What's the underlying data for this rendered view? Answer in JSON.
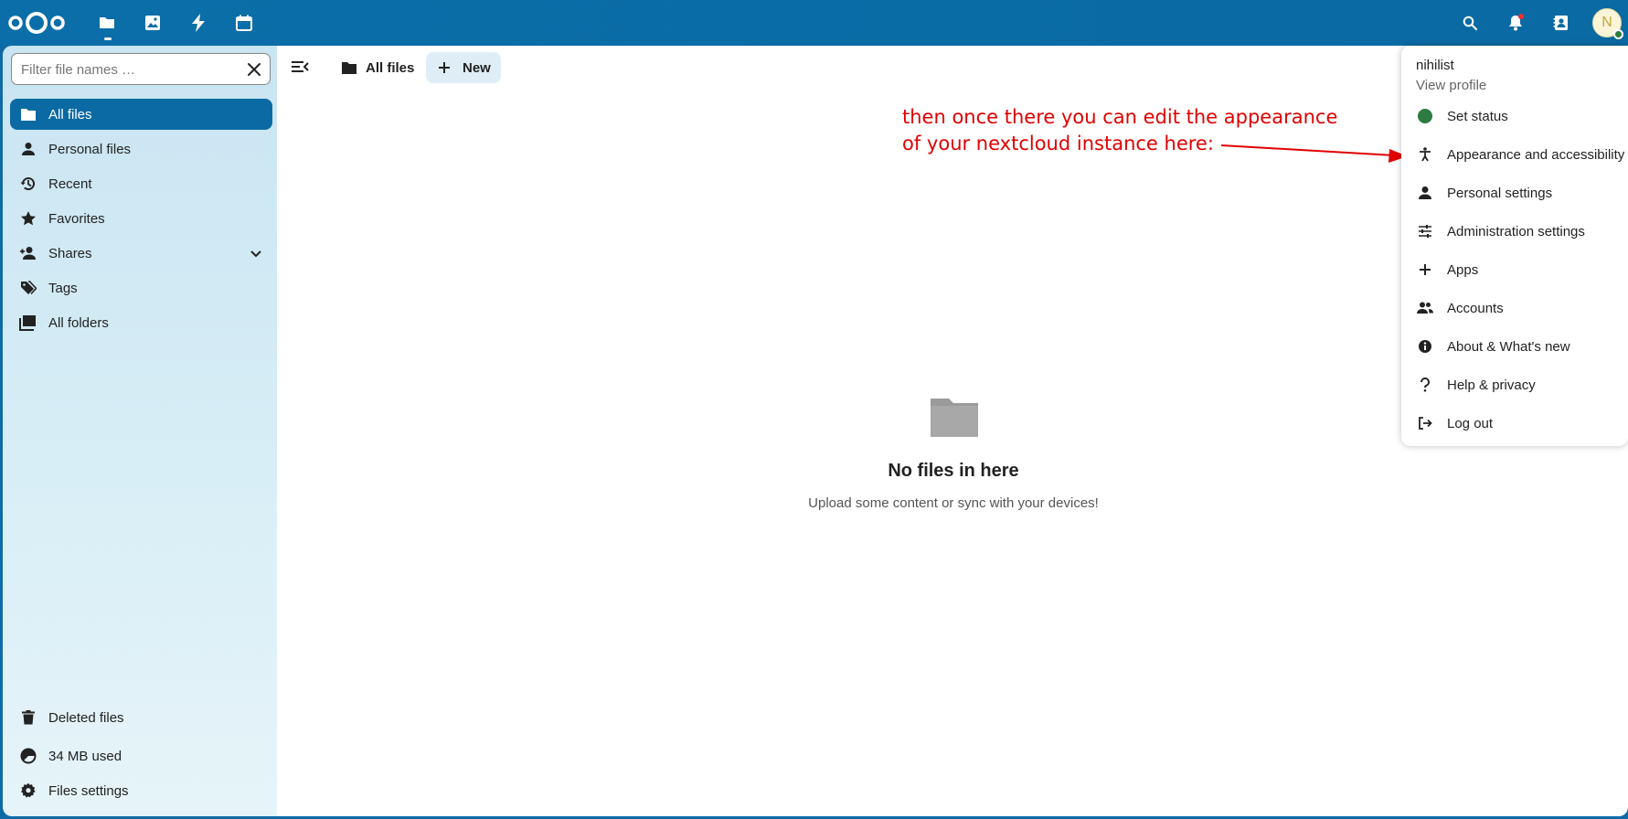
{
  "header": {
    "apps": [
      {
        "name": "Files",
        "icon": "folder-icon",
        "active": true
      },
      {
        "name": "Photos",
        "icon": "image-icon"
      },
      {
        "name": "Activity",
        "icon": "lightning-icon"
      },
      {
        "name": "Calendar",
        "icon": "calendar-icon"
      }
    ],
    "right_icons": [
      "search-icon",
      "bell-icon",
      "contacts-icon"
    ],
    "avatar_letter": "N"
  },
  "sidebar": {
    "search_placeholder": "Filter file names …",
    "items": [
      {
        "label": "All files",
        "icon": "folder-icon",
        "active": true
      },
      {
        "label": "Personal files",
        "icon": "person-icon"
      },
      {
        "label": "Recent",
        "icon": "history-icon"
      },
      {
        "label": "Favorites",
        "icon": "star-icon"
      },
      {
        "label": "Shares",
        "icon": "share-icon",
        "expandable": true
      },
      {
        "label": "Tags",
        "icon": "tag-icon"
      },
      {
        "label": "All folders",
        "icon": "folders-icon"
      }
    ],
    "bottom": {
      "deleted": "Deleted files",
      "usage": "34 MB used",
      "settings": "Files settings"
    }
  },
  "main": {
    "breadcrumb": "All files",
    "new_label": "New",
    "empty_title": "No files in here",
    "empty_subtitle": "Upload some content or sync with your devices!"
  },
  "annotation": {
    "line1": "then once there you can edit the appearance",
    "line2": "of your nextcloud instance here:",
    "color": "#e00000"
  },
  "user_menu": {
    "name": "nihilist",
    "profile": "View profile",
    "items": [
      {
        "label": "Set status",
        "icon": "status-dot-icon"
      },
      {
        "label": "Appearance and accessibility",
        "icon": "accessibility-icon"
      },
      {
        "label": "Personal settings",
        "icon": "person-icon"
      },
      {
        "label": "Administration settings",
        "icon": "sliders-icon"
      },
      {
        "label": "Apps",
        "icon": "plus-icon"
      },
      {
        "label": "Accounts",
        "icon": "accounts-icon"
      },
      {
        "label": "About & What's new",
        "icon": "info-icon"
      },
      {
        "label": "Help & privacy",
        "icon": "help-icon"
      },
      {
        "label": "Log out",
        "icon": "logout-icon"
      }
    ]
  },
  "colors": {
    "primary": "#0b6aa3",
    "status_online": "#2d7b41"
  }
}
